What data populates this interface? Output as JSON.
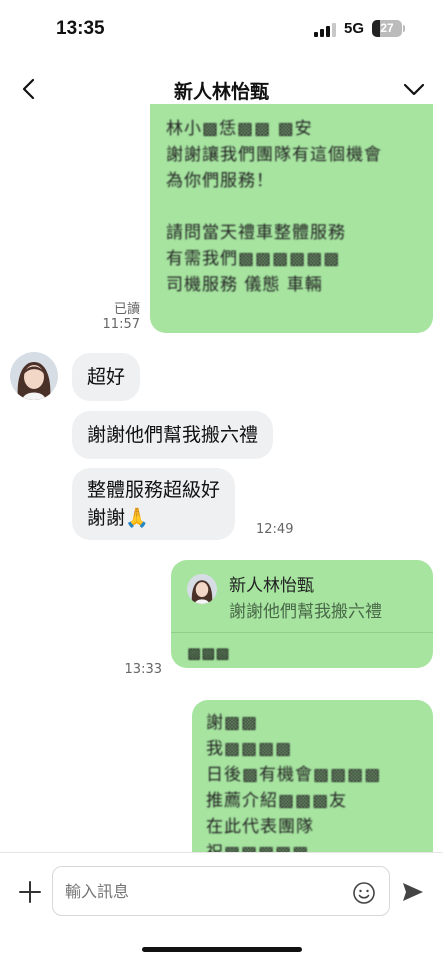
{
  "status": {
    "time": "13:35",
    "network": "5G",
    "battery": "27",
    "battery_level": 0.27
  },
  "header": {
    "title": "新人林怡甄",
    "back_icon": "chevron-left-icon",
    "menu_icon": "chevron-down-icon"
  },
  "messages": [
    {
      "id": "m1",
      "sender": "me",
      "blurred": true,
      "read": "已讀",
      "time": "11:57"
    },
    {
      "id": "m2",
      "sender": "them",
      "text": "超好"
    },
    {
      "id": "m3",
      "sender": "them",
      "text": "謝謝他們幫我搬六禮"
    },
    {
      "id": "m4",
      "sender": "them",
      "line1": "整體服務超級好",
      "line2": "謝謝🙏",
      "time": "12:49"
    },
    {
      "id": "m5",
      "sender": "me",
      "reply_name": "新人林怡甄",
      "reply_quote": "謝謝他們幫我搬六禮",
      "blurred": true,
      "time": "13:33"
    },
    {
      "id": "m6",
      "sender": "me",
      "blurred": true
    }
  ],
  "composer": {
    "placeholder": "輸入訊息",
    "plus_icon": "plus-icon",
    "emoji_icon": "smiley-icon",
    "send_icon": "send-icon"
  }
}
